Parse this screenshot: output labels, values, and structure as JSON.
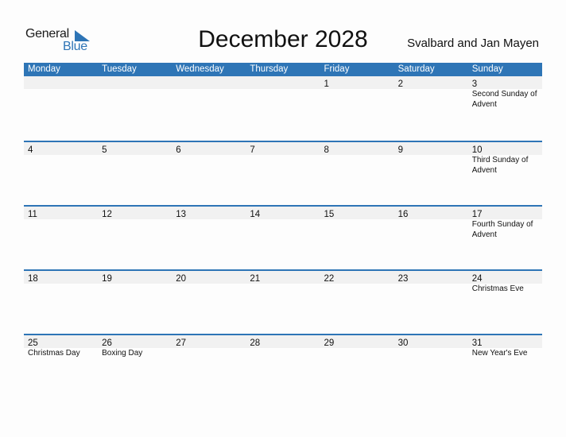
{
  "logo": {
    "general": "General",
    "blue": "Blue"
  },
  "title": "December 2028",
  "country": "Svalbard and Jan Mayen",
  "colors": {
    "accent": "#2e75b6",
    "band": "#f1f1f1"
  },
  "weekdays": [
    "Monday",
    "Tuesday",
    "Wednesday",
    "Thursday",
    "Friday",
    "Saturday",
    "Sunday"
  ],
  "weeks": [
    {
      "days": [
        "",
        "",
        "",
        "",
        "1",
        "2",
        "3"
      ],
      "events": [
        "",
        "",
        "",
        "",
        "",
        "",
        "Second Sunday of Advent"
      ]
    },
    {
      "days": [
        "4",
        "5",
        "6",
        "7",
        "8",
        "9",
        "10"
      ],
      "events": [
        "",
        "",
        "",
        "",
        "",
        "",
        "Third Sunday of Advent"
      ]
    },
    {
      "days": [
        "11",
        "12",
        "13",
        "14",
        "15",
        "16",
        "17"
      ],
      "events": [
        "",
        "",
        "",
        "",
        "",
        "",
        "Fourth Sunday of Advent"
      ]
    },
    {
      "days": [
        "18",
        "19",
        "20",
        "21",
        "22",
        "23",
        "24"
      ],
      "events": [
        "",
        "",
        "",
        "",
        "",
        "",
        "Christmas Eve"
      ]
    },
    {
      "days": [
        "25",
        "26",
        "27",
        "28",
        "29",
        "30",
        "31"
      ],
      "events": [
        "Christmas Day",
        "Boxing Day",
        "",
        "",
        "",
        "",
        "New Year's Eve"
      ]
    }
  ]
}
